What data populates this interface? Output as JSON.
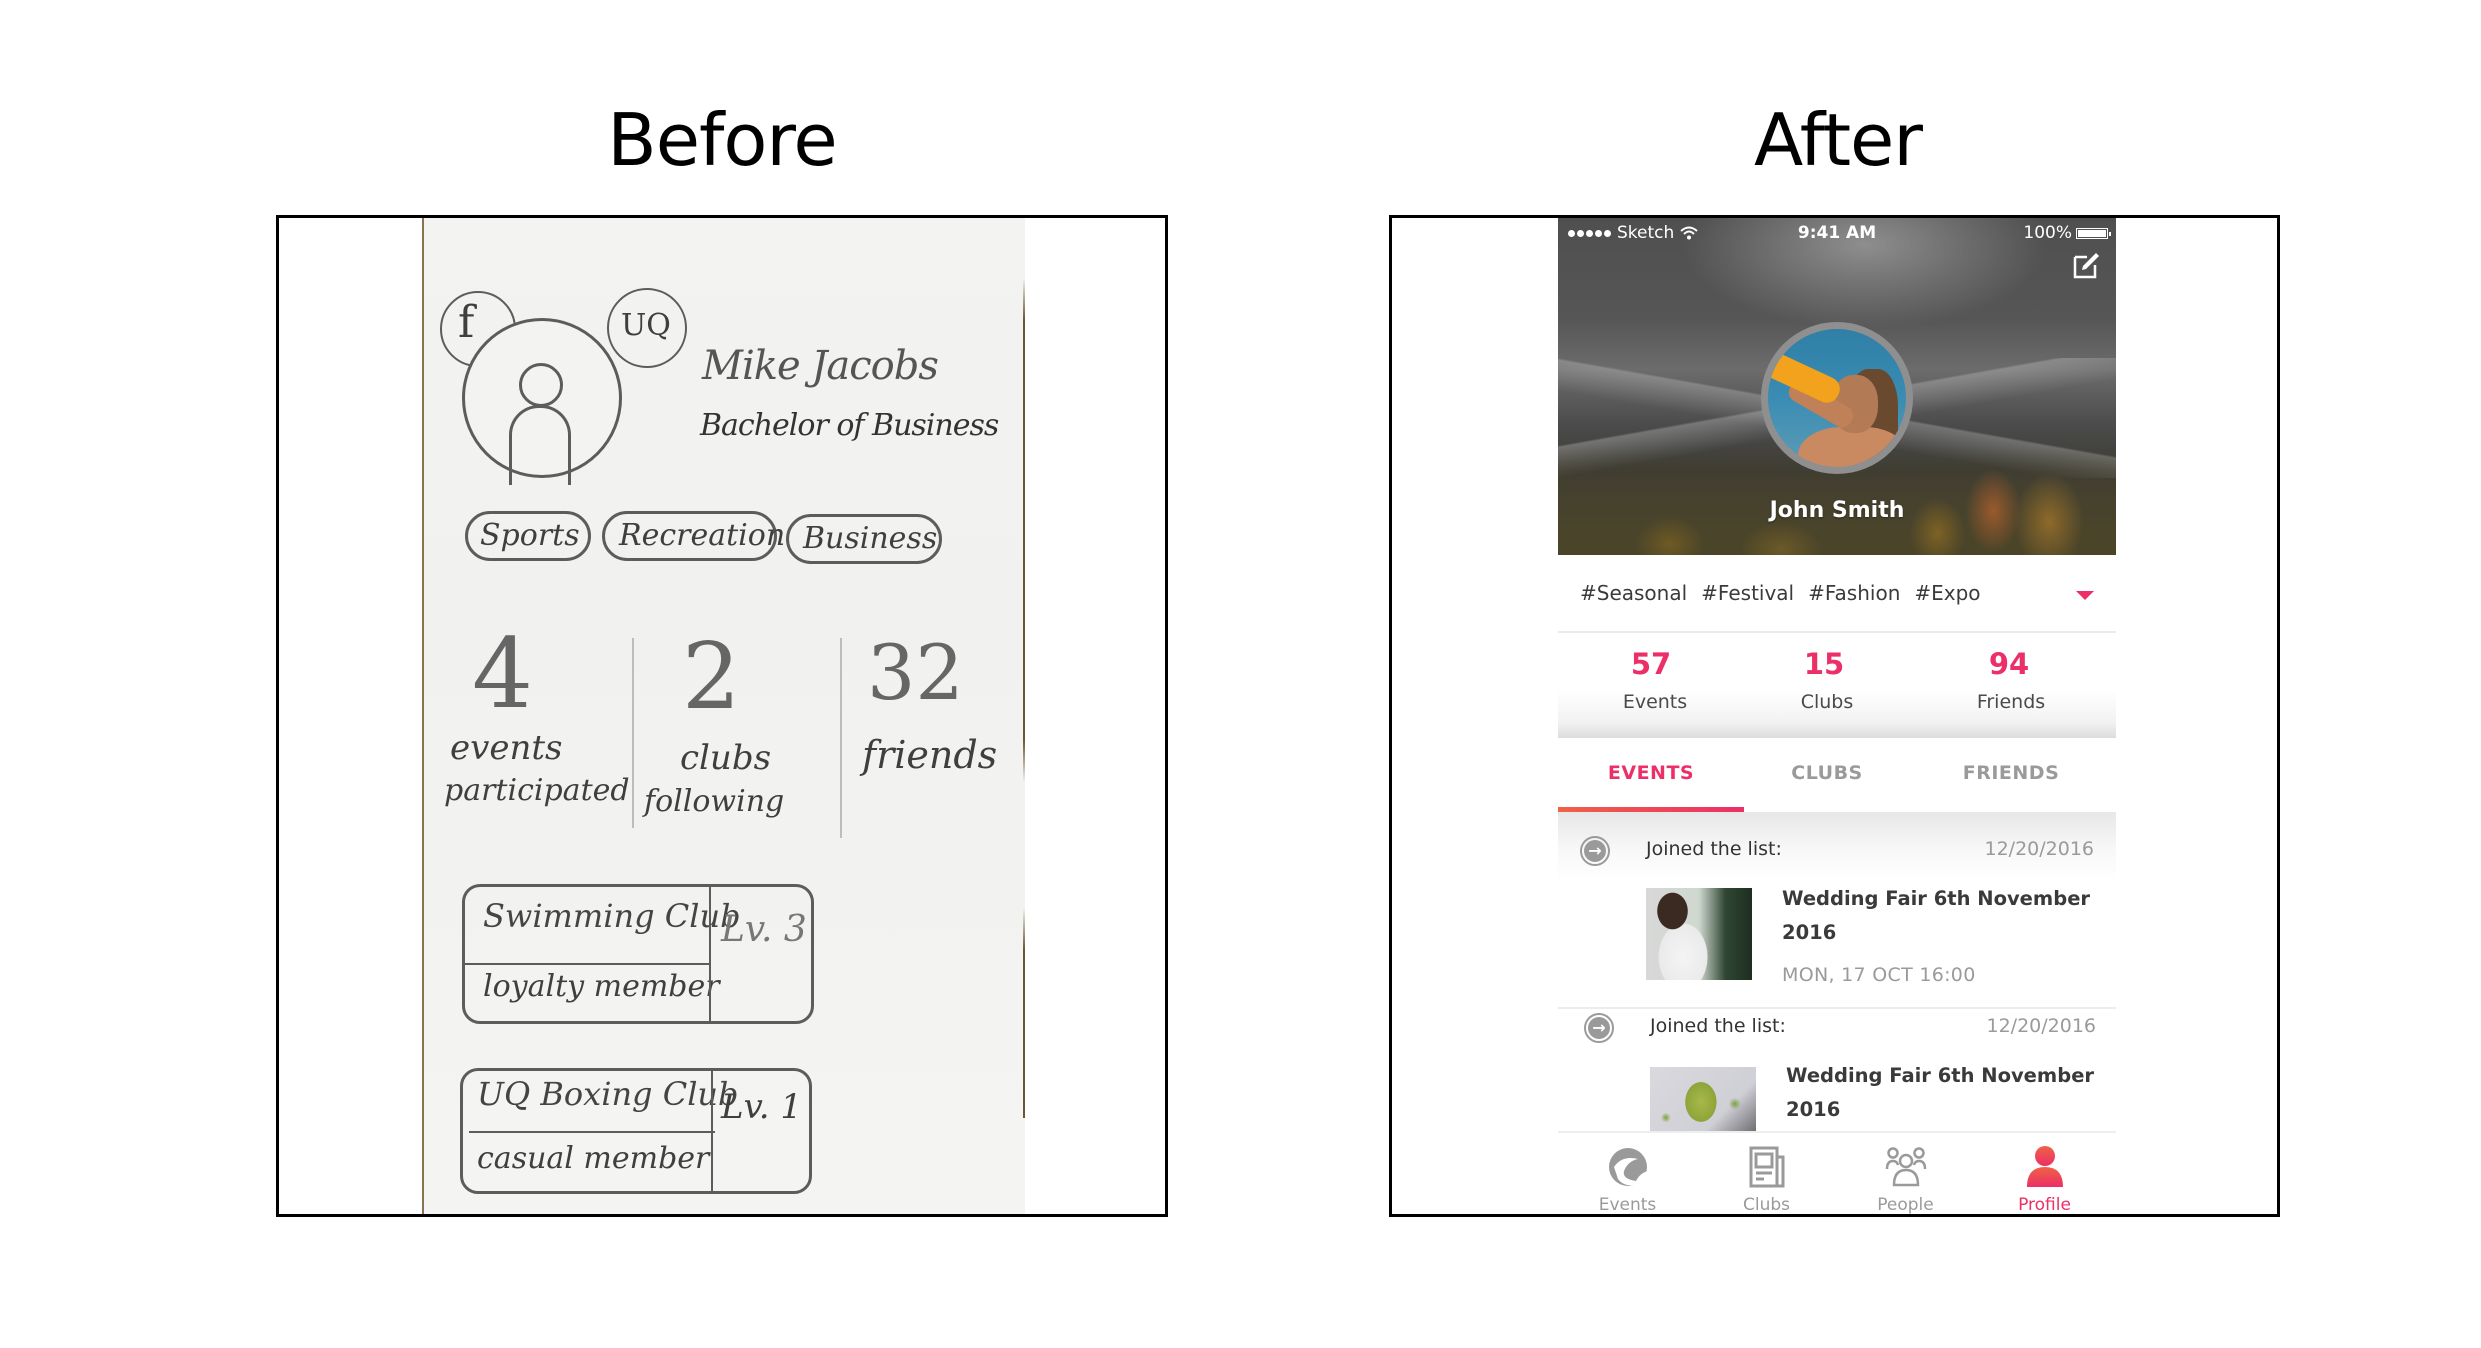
{
  "headings": {
    "before": "Before",
    "after": "After"
  },
  "before_sketch": {
    "badges": [
      "f",
      "UQ"
    ],
    "name": "Mike Jacobs",
    "degree": "Bachelor of Business",
    "interest_tags": [
      "Sports",
      "Recreation",
      "Business"
    ],
    "stats": [
      {
        "value": "4",
        "label_line1": "events",
        "label_line2": "participated"
      },
      {
        "value": "2",
        "label_line1": "clubs",
        "label_line2": "following"
      },
      {
        "value": "32",
        "label_line1": "friends",
        "label_line2": ""
      }
    ],
    "clubs": [
      {
        "name": "Swimming Club",
        "membership": "loyalty member",
        "level": "Lv. 3"
      },
      {
        "name": "UQ Boxing Club",
        "membership": "casual member",
        "level": "Lv. 1"
      }
    ]
  },
  "after_app": {
    "status_bar": {
      "carrier": "Sketch",
      "time": "9:41 AM",
      "battery": "100%"
    },
    "profile": {
      "name": "John Smith"
    },
    "tags": [
      "#Seasonal",
      "#Festival",
      "#Fashion",
      "#Expo"
    ],
    "stats": [
      {
        "value": "57",
        "label": "Events"
      },
      {
        "value": "15",
        "label": "Clubs"
      },
      {
        "value": "94",
        "label": "Friends"
      }
    ],
    "tabs": [
      {
        "label": "EVENTS",
        "active": true
      },
      {
        "label": "CLUBS",
        "active": false
      },
      {
        "label": "FRIENDS",
        "active": false
      }
    ],
    "feed": [
      {
        "action": "Joined the list:",
        "date": "12/20/2016",
        "title_line1": "Wedding Fair 6th November",
        "title_line2": "2016",
        "time": "MON, 17 OCT 16:00"
      },
      {
        "action": "Joined the list:",
        "date": "12/20/2016",
        "title_line1": "Wedding Fair 6th November",
        "title_line2": "2016",
        "time": ""
      }
    ],
    "bottom_nav": [
      {
        "label": "Events",
        "icon": "events-icon",
        "active": false
      },
      {
        "label": "Clubs",
        "icon": "newspaper-icon",
        "active": false
      },
      {
        "label": "People",
        "icon": "people-icon",
        "active": false
      },
      {
        "label": "Profile",
        "icon": "profile-icon",
        "active": true
      }
    ],
    "colors": {
      "accent": "#ec2f67",
      "accent_gradient_start": "#ef6245",
      "inactive": "#9a9a9a"
    }
  }
}
